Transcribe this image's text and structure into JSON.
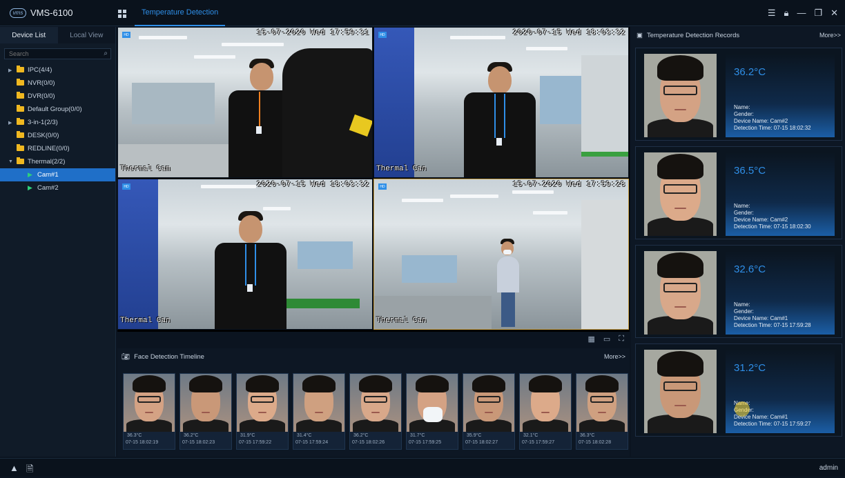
{
  "app": {
    "title": "VMS-6100",
    "logo_text": "vms"
  },
  "header": {
    "active_tab": "Temperature Detection"
  },
  "left_panel": {
    "tabs": [
      "Device List",
      "Local View"
    ],
    "search_placeholder": "Search",
    "tree": [
      {
        "label": "IPC(4/4)",
        "expandable": true
      },
      {
        "label": "NVR(0/0)",
        "expandable": false
      },
      {
        "label": "DVR(0/0)",
        "expandable": false
      },
      {
        "label": "Default Group(0/0)",
        "expandable": false
      },
      {
        "label": "3-in-1(2/3)",
        "expandable": true
      },
      {
        "label": "DESK(0/0)",
        "expandable": false
      },
      {
        "label": "REDLINE(0/0)",
        "expandable": false
      },
      {
        "label": "Thermal(2/2)",
        "expandable": true,
        "expanded": true
      }
    ],
    "cameras": [
      "Cam#1",
      "Cam#2"
    ]
  },
  "video": {
    "cells": [
      {
        "time": "15-07-2020 Wed 17:59:31",
        "name": "Thermal Cam"
      },
      {
        "time": "2020-07-15 Wed 18:03:32",
        "name": "Thermal Can"
      },
      {
        "time": "2020-07-15 Wed 18:03:32",
        "name": "Thermal Can"
      },
      {
        "time": "15-07-2020 Wed 17:59:28",
        "name": "Thermal Can"
      }
    ]
  },
  "timeline": {
    "title": "Face Detection Timeline",
    "more": "More>>",
    "items": [
      {
        "temp": "36.3°C",
        "time": "07-15 18:02:19"
      },
      {
        "temp": "36.2°C",
        "time": "07-15 18:02:23"
      },
      {
        "temp": "31.9°C",
        "time": "07-15 17:59:22"
      },
      {
        "temp": "31.4°C",
        "time": "07-15 17:59:24"
      },
      {
        "temp": "36.2°C",
        "time": "07-15 18:02:26"
      },
      {
        "temp": "31.7°C",
        "time": "07-15 17:59:25"
      },
      {
        "temp": "35.9°C",
        "time": "07-15 18:02:27"
      },
      {
        "temp": "32.1°C",
        "time": "07-15 17:59:27"
      },
      {
        "temp": "36.3°C",
        "time": "07-15 18:02:28"
      }
    ]
  },
  "records": {
    "title": "Temperature Detection Records",
    "more": "More>>",
    "items": [
      {
        "temp": "36.2°C",
        "name": "Name:",
        "gender": "Gender:",
        "device": "Device Name: Cam#2",
        "time": "Detection Time: 07-15 18:02:32"
      },
      {
        "temp": "36.5°C",
        "name": "Name:",
        "gender": "Gender:",
        "device": "Device Name: Cam#2",
        "time": "Detection Time: 07-15 18:02:30"
      },
      {
        "temp": "32.6°C",
        "name": "Name:",
        "gender": "Gender:",
        "device": "Device Name: Cam#1",
        "time": "Detection Time: 07-15 17:59:28"
      },
      {
        "temp": "31.2°C",
        "name": "Name:",
        "gender": "Gender:",
        "device": "Device Name: Cam#1",
        "time": "Detection Time: 07-15 17:59:27"
      }
    ]
  },
  "status": {
    "user": "admin"
  },
  "colors": {
    "accent": "#2f8fe8",
    "folder": "#f0b820",
    "online": "#2fd07a",
    "selected": "#1f6fc8"
  }
}
